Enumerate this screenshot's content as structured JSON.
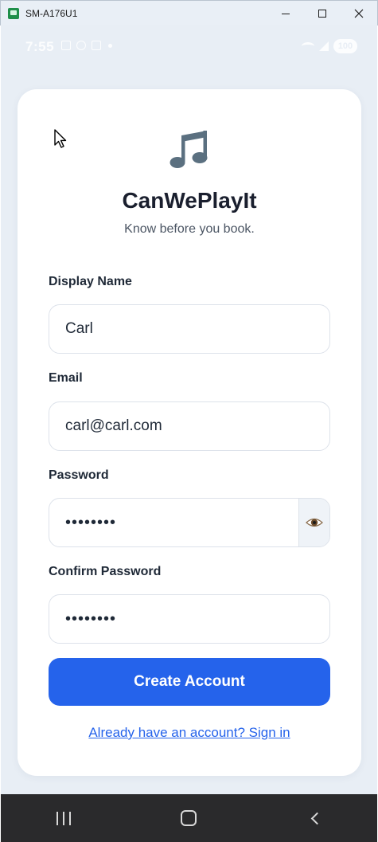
{
  "window": {
    "title": "SM-A176U1"
  },
  "status_bar": {
    "time": "7:55",
    "battery": "100"
  },
  "app": {
    "name": "CanWePlayIt",
    "tagline": "Know before you book.",
    "logo_icon": "music-note-icon"
  },
  "form": {
    "display_name": {
      "label": "Display Name",
      "value": "Carl"
    },
    "email": {
      "label": "Email",
      "value": "carl@carl.com"
    },
    "password": {
      "label": "Password",
      "value": "••••••••",
      "toggle_icon": "eye-icon"
    },
    "confirm_password": {
      "label": "Confirm Password",
      "value": "••••••••"
    },
    "submit_label": "Create Account",
    "signin_link": "Already have an account? Sign in"
  },
  "colors": {
    "primary": "#2563eb",
    "screen_background": "#e8eef5",
    "heading": "#1a1f2e",
    "icon": "#5b7080"
  }
}
